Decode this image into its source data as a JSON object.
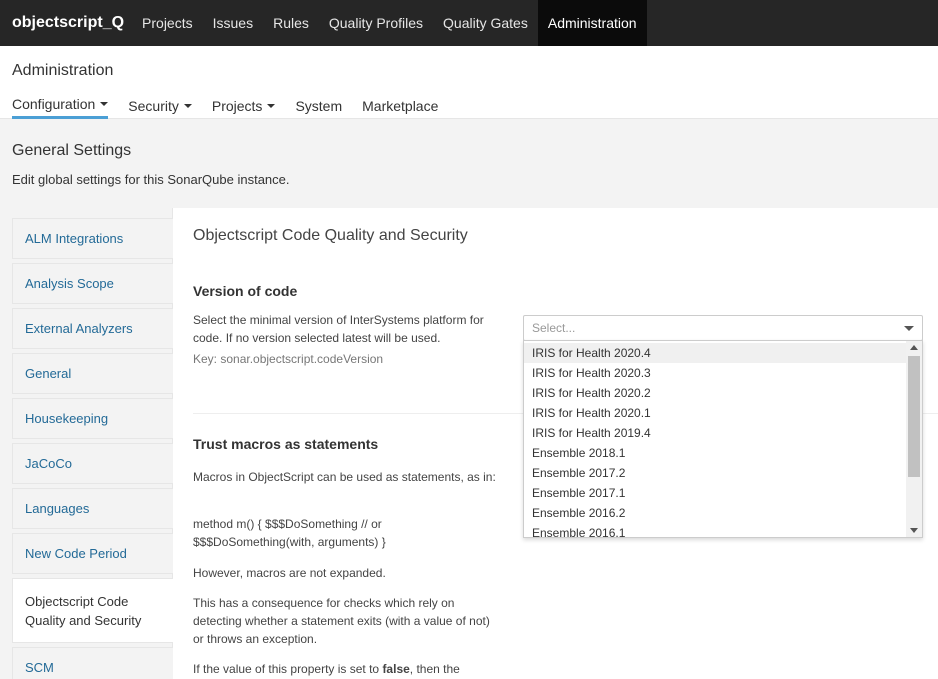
{
  "topnav": {
    "brand": "objectscript_Q",
    "items": [
      {
        "label": "Projects"
      },
      {
        "label": "Issues"
      },
      {
        "label": "Rules"
      },
      {
        "label": "Quality Profiles"
      },
      {
        "label": "Quality Gates"
      },
      {
        "label": "Administration",
        "active": true
      }
    ]
  },
  "admin": {
    "title": "Administration",
    "tabs": [
      {
        "label": "Configuration",
        "dropdown": true,
        "active": true
      },
      {
        "label": "Security",
        "dropdown": true
      },
      {
        "label": "Projects",
        "dropdown": true
      },
      {
        "label": "System",
        "dropdown": false
      },
      {
        "label": "Marketplace",
        "dropdown": false
      }
    ]
  },
  "page": {
    "title": "General Settings",
    "description": "Edit global settings for this SonarQube instance."
  },
  "categories": [
    {
      "label": "ALM Integrations"
    },
    {
      "label": "Analysis Scope"
    },
    {
      "label": "External Analyzers"
    },
    {
      "label": "General"
    },
    {
      "label": "Housekeeping"
    },
    {
      "label": "JaCoCo"
    },
    {
      "label": "Languages"
    },
    {
      "label": "New Code Period"
    },
    {
      "label": "Objectscript Code Quality and Security",
      "active": true
    },
    {
      "label": "SCM"
    }
  ],
  "section": {
    "title": "Objectscript Code Quality and Security"
  },
  "setting_version": {
    "title": "Version of code",
    "description": "Select the minimal version of InterSystems platform for code. If no version selected latest will be used.",
    "key": "Key: sonar.objectscript.codeVersion",
    "select_placeholder": "Select...",
    "options": [
      {
        "label": "IRIS for Health 2020.4",
        "highlighted": true
      },
      {
        "label": "IRIS for Health 2020.3"
      },
      {
        "label": "IRIS for Health 2020.2"
      },
      {
        "label": "IRIS for Health 2020.1"
      },
      {
        "label": "IRIS for Health 2019.4"
      },
      {
        "label": "Ensemble 2018.1"
      },
      {
        "label": "Ensemble 2017.2"
      },
      {
        "label": "Ensemble 2017.1"
      },
      {
        "label": "Ensemble 2016.2"
      },
      {
        "label": "Ensemble 2016.1"
      }
    ]
  },
  "setting_macros": {
    "title": "Trust macros as statements",
    "para1": "Macros in ObjectScript can be used as statements, as in:",
    "para2": "method m() { $$$DoSomething // or $$$DoSomething(with, arguments) }",
    "para3": "However, macros are not expanded.",
    "para4": "This has a consequence for checks which rely on detecting whether a statement exits (with a value of not) or throws an exception.",
    "para5_prefix": "If the value of this property is set to ",
    "para5_bold": "false",
    "para5_suffix": ", then the"
  }
}
